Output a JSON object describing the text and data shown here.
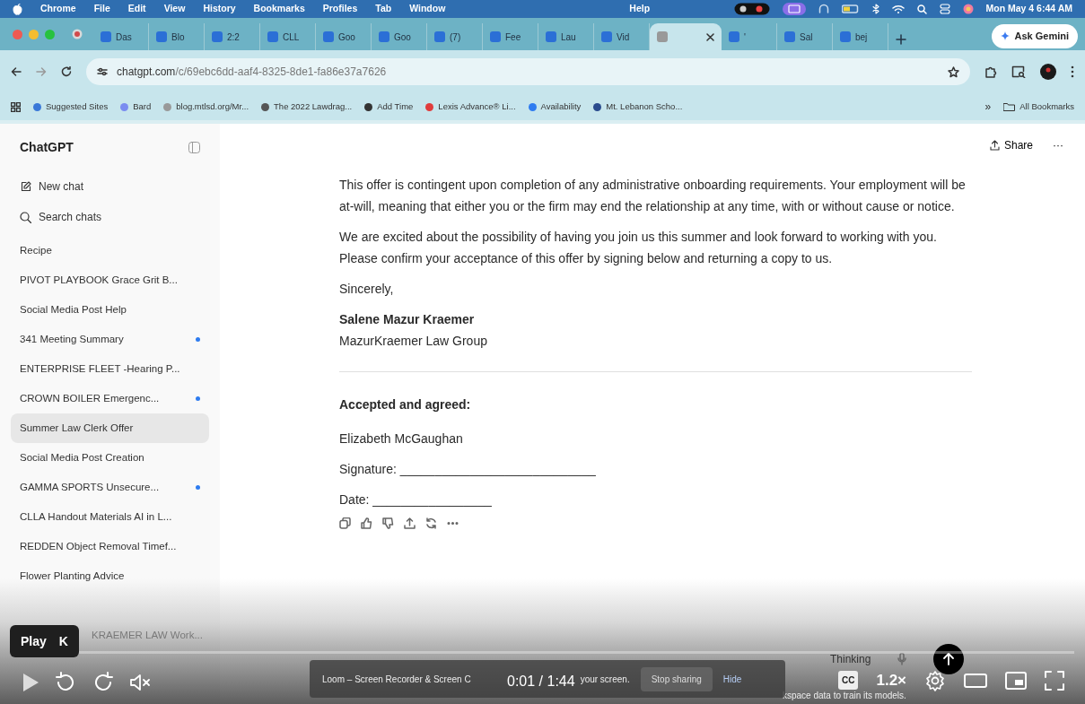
{
  "menubar": {
    "app": "Chrome",
    "menus": [
      "File",
      "Edit",
      "View",
      "History",
      "Bookmarks",
      "Profiles",
      "Tab",
      "Window",
      "Help"
    ],
    "clock": "Mon May 4  6:44 AM"
  },
  "tabs": [
    {
      "label": "Das",
      "selected": false
    },
    {
      "label": "Blo",
      "selected": false
    },
    {
      "label": "2:2",
      "selected": false
    },
    {
      "label": "CLL",
      "selected": false
    },
    {
      "label": "Goo",
      "selected": false
    },
    {
      "label": "Goo",
      "selected": false
    },
    {
      "label": "(7)",
      "selected": false
    },
    {
      "label": "Fee",
      "selected": false
    },
    {
      "label": "Lau",
      "selected": false
    },
    {
      "label": "Vid",
      "selected": false
    },
    {
      "selected": true
    },
    {
      "label": "'",
      "selected": false
    },
    {
      "label": "Sal",
      "selected": false
    },
    {
      "label": "bej",
      "selected": false
    }
  ],
  "ask_gemini": "Ask Gemini",
  "address": {
    "host": "chatgpt.com",
    "path": "/c/69ebc6dd-aaf4-8325-8de1-fa86e37a7626"
  },
  "bookmarks": [
    "Suggested Sites",
    "Bard",
    "blog.mtlsd.org/Mr...",
    "The 2022 Lawdrag...",
    "Add Time",
    "Lexis Advance® Li...",
    "Availability",
    "Mt. Lebanon Scho..."
  ],
  "bookmarks_overflow": "»",
  "all_bookmarks": "All Bookmarks",
  "sidebar": {
    "title": "ChatGPT",
    "actions": [
      {
        "kind": "new",
        "label": "New chat"
      },
      {
        "kind": "search",
        "label": "Search chats"
      }
    ],
    "chats": [
      {
        "label": "Recipe",
        "selected": false,
        "unread": false
      },
      {
        "label": "PIVOT PLAYBOOK Grace Grit B...",
        "selected": false,
        "unread": false
      },
      {
        "label": "Social Media Post Help",
        "selected": false,
        "unread": false
      },
      {
        "label": "341 Meeting Summary",
        "selected": false,
        "unread": true
      },
      {
        "label": "ENTERPRISE FLEET -Hearing P...",
        "selected": false,
        "unread": false
      },
      {
        "label": "CROWN BOILER Emergenc...",
        "selected": false,
        "unread": true
      },
      {
        "label": "Summer Law Clerk Offer",
        "selected": true,
        "unread": false
      },
      {
        "label": "Social Media Post Creation",
        "selected": false,
        "unread": false
      },
      {
        "label": "GAMMA SPORTS Unsecure...",
        "selected": false,
        "unread": true
      },
      {
        "label": "CLLA Handout Materials AI in L...",
        "selected": false,
        "unread": false
      },
      {
        "label": "REDDEN Object Removal Timef...",
        "selected": false,
        "unread": false
      },
      {
        "label": "Flower Planting Advice",
        "selected": false,
        "unread": false
      }
    ],
    "partial_chat": "KRAEMER LAW Work..."
  },
  "header": {
    "share": "Share",
    "more": "···"
  },
  "letter": [
    {
      "kind": "para",
      "text": "This offer is contingent upon completion of any administrative onboarding requirements. Your employment will be at-will, meaning that either you or the firm may end the relationship at any time, with or without cause or notice."
    },
    {
      "kind": "para",
      "text": "We are excited about the possibility of having you join us this summer and look forward to working with you. Please confirm your acceptance of this offer by signing below and returning a copy to us."
    },
    {
      "kind": "para",
      "text": "Sincerely,"
    },
    {
      "kind": "bold",
      "text": "Salene Mazur Kraemer"
    },
    {
      "kind": "line",
      "text": "MazurKraemer Law Group"
    },
    {
      "kind": "rule"
    },
    {
      "kind": "heading",
      "text": "Accepted and agreed:"
    },
    {
      "kind": "para",
      "text": "Elizabeth McGaughan"
    },
    {
      "kind": "para",
      "text": "Signature: ____________________________"
    },
    {
      "kind": "para",
      "text": "Date: _________________"
    }
  ],
  "composer": {
    "mode": "Thinking"
  },
  "disclaimer": "kspace data to train its models.",
  "loom": {
    "text": "Loom – Screen Recorder & Screen C",
    "tail": "your screen.",
    "stop": "Stop sharing",
    "hide": "Hide"
  },
  "player": {
    "tooltip": {
      "label": "Play",
      "key": "K"
    },
    "time": "0:01 / 1:44",
    "cc": "CC",
    "speed": "1.2×",
    "progress": {
      "level": 0.01
    }
  }
}
